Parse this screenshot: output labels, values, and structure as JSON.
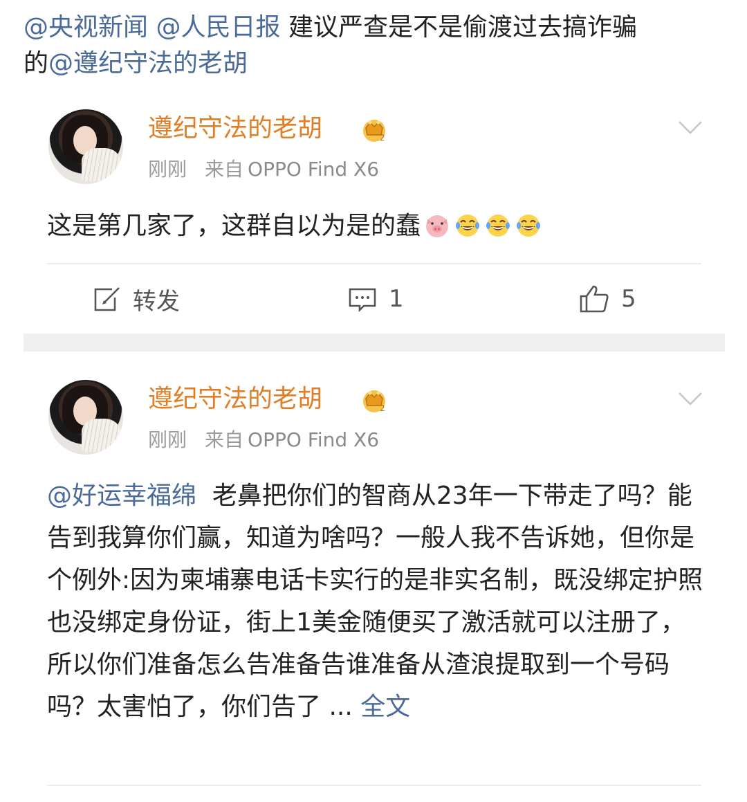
{
  "header": {
    "mention_1": "@央视新闻",
    "mention_2": "@人民日报",
    "text_1": "建议严查是不是偷渡过去搞诈骗",
    "text_2": "的",
    "mention_3": "@遵纪守法的老胡"
  },
  "posts": [
    {
      "username": "遵纪守法的老胡",
      "time": "刚刚",
      "source_label": "来自",
      "device": "OPPO Find X6",
      "content": "这是第几家了，这群自以为是的蠢",
      "emojis": [
        "pig-face-emoji",
        "laughing-tears-emoji",
        "laughing-tears-emoji",
        "laughing-tears-emoji"
      ],
      "actions": {
        "repost_label": "转发",
        "comment_count": "1",
        "like_count": "5"
      }
    },
    {
      "username": "遵纪守法的老胡",
      "time": "刚刚",
      "source_label": "来自",
      "device": "OPPO Find X6",
      "mention": "@好运幸福绵",
      "content": "老鼻把你们的智商从23年一下带走了吗？能告到我算你们赢，知道为啥吗？一般人我不告诉她，但你是个例外:因为柬埔寨电话卡实行的是非实名制，既没绑定护照也没绑定身份证，街上1美金随便买了激活就可以注册了，所以你们准备怎么告准备告谁准备从渣浪提取到一个号码吗？太害怕了，你们告了",
      "ellipsis": "...",
      "fulltext_label": "全文"
    }
  ],
  "colors": {
    "username": "#e07f25",
    "mention": "#4a6a99",
    "meta": "#9a9a9a"
  }
}
